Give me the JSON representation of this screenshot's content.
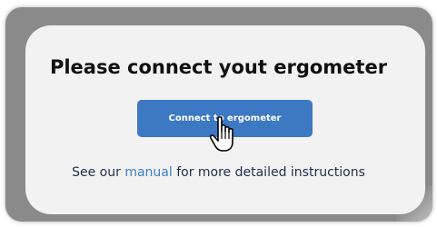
{
  "dialog": {
    "title": "Please connect yout ergometer",
    "connect_button_label": "Connect to ergometer",
    "instructions_prefix": "See our ",
    "manual_link_text": "manual",
    "instructions_suffix": " for more detailed instructions"
  },
  "cursor": {
    "icon": "hand-pointer-icon"
  },
  "colors": {
    "frame": "#8a8a8a",
    "card_background": "#f2f2f2",
    "button": "#3d78c2",
    "link": "#3c7fc4",
    "text": "#1f2f4a"
  }
}
